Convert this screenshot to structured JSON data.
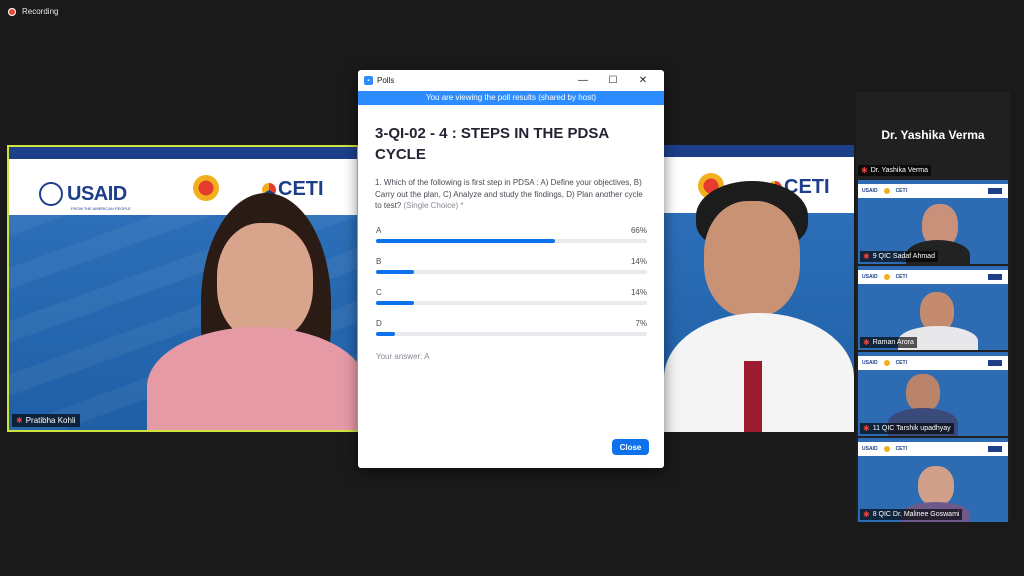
{
  "recording": {
    "label": "Recording"
  },
  "brand": {
    "usaid": "USAID",
    "usaid_sub": "FROM THE AMERICAN PEOPLE",
    "ceti": "CETI"
  },
  "speakers": {
    "left_name": "Pratibha  Kohli"
  },
  "gallery": {
    "host": "Dr. Yashika Verma",
    "tiles": [
      {
        "name": "Dr. Yashika Verma"
      },
      {
        "name": "9 QIC Sadaf Ahmad"
      },
      {
        "name": "Raman Arora"
      },
      {
        "name": "11 QIC Tarshik upadhyay"
      },
      {
        "name": "8 QIC Dr. Malinee Goswami"
      }
    ]
  },
  "poll": {
    "window_title": "Polls",
    "shared_notice": "You are viewing the poll results (shared by host)",
    "title": "3-QI-02 - 4 : STEPS IN THE PDSA CYCLE",
    "question": "1. Which of the following is first step in PDSA : A) Define your objectives, B) Carry out the plan, C) Analyze and study the findings, D) Plan another cycle to test?",
    "question_tag": "(Single Choice)  *",
    "options": [
      {
        "label": "A",
        "percent_text": "66%",
        "percent": 66
      },
      {
        "label": "B",
        "percent_text": "14%",
        "percent": 14
      },
      {
        "label": "C",
        "percent_text": "14%",
        "percent": 14
      },
      {
        "label": "D",
        "percent_text": "7%",
        "percent": 7
      }
    ],
    "your_answer": "Your answer: A",
    "close_label": "Close"
  },
  "colors": {
    "accent": "#0e72ed",
    "shared_bar": "#2d8cff",
    "active_speaker_border": "#cfe33f",
    "mic_off": "#e8453c"
  }
}
